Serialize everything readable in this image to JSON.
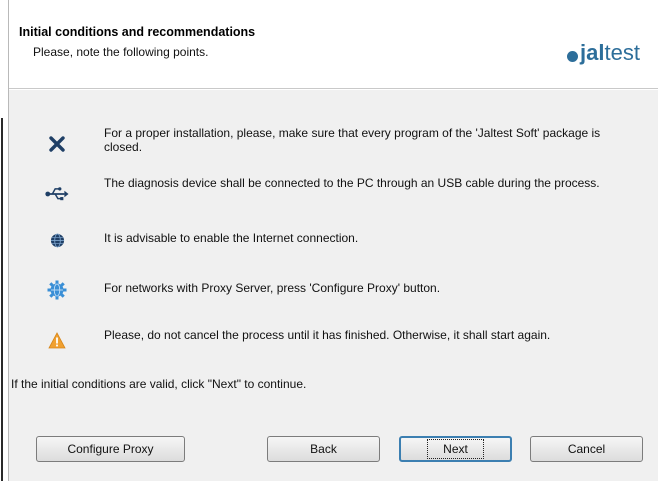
{
  "header": {
    "title": "Initial conditions and recommendations",
    "subtitle": "Please, note the following points.",
    "logo": {
      "prefix": "j",
      "strong": "al",
      "suffix": "test",
      "color": "#2d6e9a"
    }
  },
  "items": [
    {
      "icon": "close-x-icon",
      "text": "For a proper installation, please, make sure that every program of the 'Jaltest Soft' package is closed."
    },
    {
      "icon": "usb-icon",
      "text": "The diagnosis device shall be connected to the PC through an USB cable during the process."
    },
    {
      "icon": "globe-icon",
      "text": "It is advisable to enable the Internet connection."
    },
    {
      "icon": "network-gear-icon",
      "text": "For networks with Proxy Server, press 'Configure Proxy' button."
    },
    {
      "icon": "warning-icon",
      "text": "Please, do not cancel the process until it has finished. Otherwise, it shall start again."
    }
  ],
  "footer_note": "If the initial conditions are valid, click \"Next\" to continue.",
  "buttons": {
    "configure_proxy": "Configure Proxy",
    "back": "Back",
    "next": "Next",
    "cancel": "Cancel"
  },
  "colors": {
    "accent": "#2d6e9a",
    "warning": "#f0a030",
    "close": "#1f3f66"
  }
}
